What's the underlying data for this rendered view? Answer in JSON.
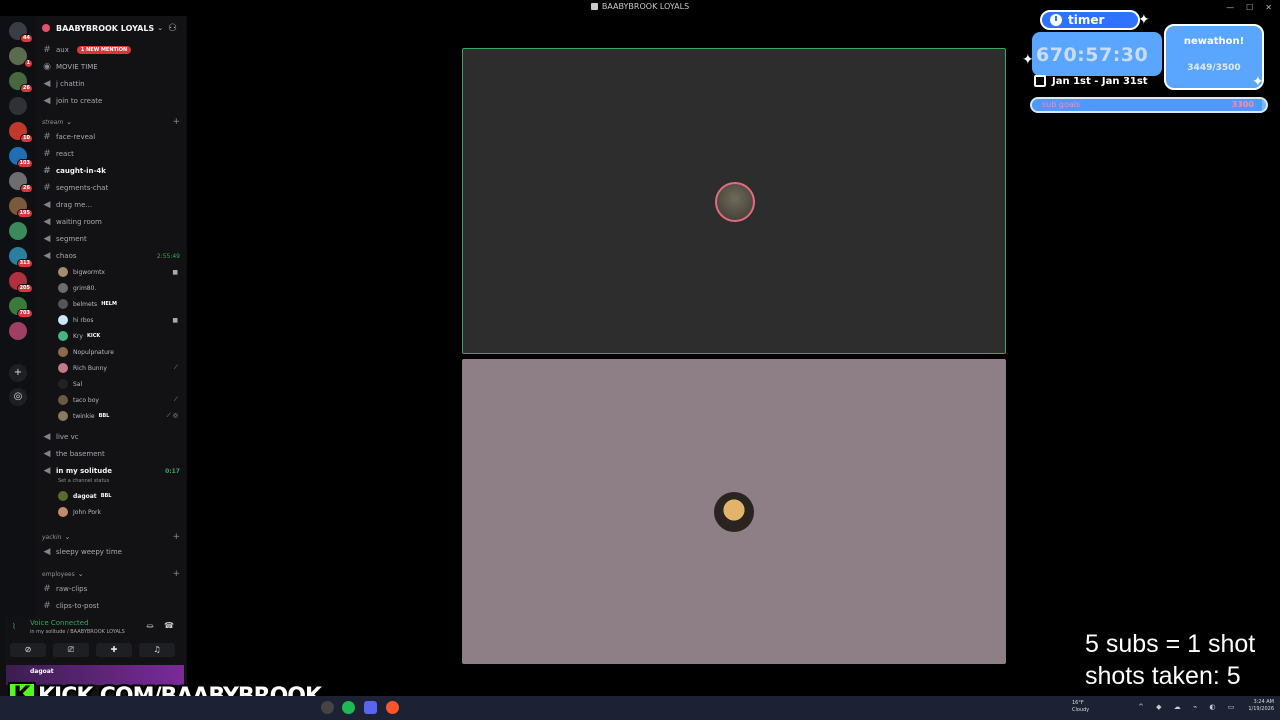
{
  "window": {
    "title": "BAABYBROOK LOYALS"
  },
  "rail": {
    "servers": [
      {
        "badge": "44",
        "color": "#3b3d45"
      },
      {
        "badge": "1",
        "color": "#5a6b4e"
      },
      {
        "badge": "26",
        "color": "#46683f"
      },
      {
        "badge": "",
        "color": "#2f3136"
      },
      {
        "badge": "10",
        "color": "#c0392b"
      },
      {
        "badge": "103",
        "color": "#1f6fb2"
      },
      {
        "badge": "26",
        "color": "#6e6e6e"
      },
      {
        "badge": "195",
        "color": "#7a5a3a"
      },
      {
        "badge": "",
        "color": "#3a8a5a"
      },
      {
        "badge": "313",
        "color": "#2a7f9e"
      },
      {
        "badge": "205",
        "color": "#b03040"
      },
      {
        "badge": "703",
        "color": "#3b7a3b"
      },
      {
        "badge": "",
        "color": "#a04060"
      }
    ]
  },
  "sidebar": {
    "server_name": "BAABYBROOK LOYALS",
    "channels_top": [
      {
        "glyph": "#",
        "label": "aux",
        "mention": "1 NEW MENTION"
      },
      {
        "glyph": "◉",
        "label": "MOVIE TIME"
      },
      {
        "glyph": "🔊",
        "label": "j chattin"
      },
      {
        "glyph": "🔊",
        "label": "join to create"
      }
    ],
    "cat_stream": "stream",
    "stream_channels": [
      {
        "glyph": "#",
        "label": "face-reveal"
      },
      {
        "glyph": "#",
        "label": "react"
      },
      {
        "glyph": "#",
        "label": "caught-in-4k",
        "bold": true
      },
      {
        "glyph": "#",
        "label": "segments-chat"
      },
      {
        "glyph": "🔊",
        "label": "drag me..."
      },
      {
        "glyph": "🔊",
        "label": "waiting room"
      },
      {
        "glyph": "🔊",
        "label": "segment"
      },
      {
        "glyph": "🔊",
        "label": "chaos",
        "timer": "2:55:49"
      }
    ],
    "chaos_users": [
      {
        "name": "bigwormtx",
        "tag": "",
        "right": "■",
        "color": "#a58b6f"
      },
      {
        "name": "grim80.",
        "tag": "",
        "right": "",
        "color": "#6d6d6d"
      },
      {
        "name": "belmets",
        "tag": "HELM",
        "right": "",
        "color": "#555"
      },
      {
        "name": "hi rbos",
        "tag": "",
        "right": "■",
        "color": "#c9e6ff"
      },
      {
        "name": "Kry",
        "tag": "KICK",
        "right": "",
        "color": "#43b581"
      },
      {
        "name": "Nopulpnature",
        "tag": "",
        "right": "",
        "color": "#8b6a4e"
      },
      {
        "name": "Rich Bunny",
        "tag": "",
        "right": "⟋",
        "color": "#c07a8a"
      },
      {
        "name": "Sal",
        "tag": "",
        "right": "",
        "color": "#222"
      },
      {
        "name": "taco boy",
        "tag": "",
        "right": "⟋",
        "color": "#6b5b3e"
      },
      {
        "name": "twinkie",
        "tag": "BBL",
        "right": "⟋ ◎",
        "color": "#8a7a60"
      }
    ],
    "channels_mid": [
      {
        "glyph": "🔊",
        "label": "live vc"
      },
      {
        "glyph": "🔊",
        "label": "the basement"
      },
      {
        "glyph": "🔊",
        "label": "in my solitude",
        "timer": "0:17",
        "bold": true
      }
    ],
    "channel_status": "Set a channel status",
    "solitude_users": [
      {
        "name": "dagoat",
        "tag": "BBL",
        "color": "#556b2f",
        "bold": true
      },
      {
        "name": "John Pork",
        "tag": "",
        "color": "#c58a6a"
      }
    ],
    "cat_yackin": "yackin",
    "yackin_channels": [
      {
        "glyph": "🔊",
        "label": "sleepy weepy time"
      }
    ],
    "cat_employees": "employees",
    "employee_channels": [
      {
        "glyph": "#",
        "label": "raw-clips"
      },
      {
        "glyph": "#",
        "label": "clips-to-post"
      }
    ]
  },
  "voice": {
    "status": "Voice Connected",
    "location": "in my solitude / BAABYBROOK LOYALS",
    "user": "dagoat"
  },
  "overlay": {
    "kick_letter": "K",
    "kick_url": "KICK.COM/BAABYBROOK",
    "timer_label": "timer",
    "timer_value": "670:57:30",
    "newathon": "newathon!",
    "sub_count": "3449/3500",
    "dates": "Jan 1st - Jan 31st",
    "progress_label": "sub goals",
    "progress_goal": "3300",
    "progress_fraction": 0.985,
    "subs_rule": "5 subs = 1 shot",
    "shots_taken": "shots taken: 5"
  },
  "taskbar": {
    "weather_temp": "16°F",
    "weather_desc": "Cloudy",
    "time": "3:24 AM",
    "date": "1/19/2026"
  }
}
